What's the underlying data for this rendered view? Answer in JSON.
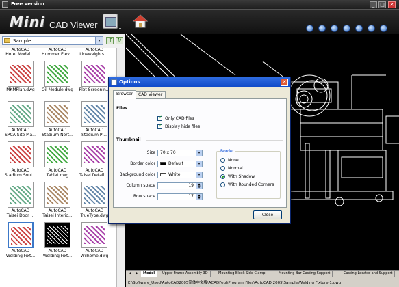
{
  "window": {
    "title": "Free version",
    "min": "_",
    "max": "□",
    "close": "✕"
  },
  "header": {
    "logo_main": "Mini",
    "logo_sub": "CAD Viewer",
    "dropdown_caret": "▾"
  },
  "folder": {
    "name": "Sample",
    "caret": "▾"
  },
  "thumbnails": [
    {
      "top": "AutoCAD",
      "name": "Hotel Model...."
    },
    {
      "top": "AutoCAD",
      "name": "Hummer Elev..."
    },
    {
      "top": "AutoCAD",
      "name": "Lineweights...."
    },
    {
      "top": "",
      "name": "MKMPlan.dwg"
    },
    {
      "top": "",
      "name": "Oil Module.dwg"
    },
    {
      "top": "",
      "name": "Plot Screenin..."
    },
    {
      "top": "AutoCAD",
      "name": "SPCA Site Pla..."
    },
    {
      "top": "AutoCAD",
      "name": "Stadium Nort..."
    },
    {
      "top": "AutoCAD",
      "name": "Stadium Pl..."
    },
    {
      "top": "AutoCAD",
      "name": "Stadium Sout..."
    },
    {
      "top": "AutoCAD",
      "name": "Tablet.dwg"
    },
    {
      "top": "AutoCAD",
      "name": "Taisei Detail ..."
    },
    {
      "top": "AutoCAD",
      "name": "Taisei Door ..."
    },
    {
      "top": "AutoCAD",
      "name": "Taisei Interio..."
    },
    {
      "top": "AutoCAD",
      "name": "TrueType.dwg"
    },
    {
      "top": "AutoCAD",
      "name": "Welding Fixt..."
    },
    {
      "top": "AutoCAD",
      "name": "Welding Fixt..."
    },
    {
      "top": "AutoCAD",
      "name": "Wilhome.dwg"
    }
  ],
  "tabs": [
    "Model",
    "Upper Frame Assembly 3D",
    "Mounting Block Side Clamp",
    "Mounting Bar Casting Support",
    "Casting Locator and Support"
  ],
  "tab_nav": {
    "prev": "◀",
    "next": "▶"
  },
  "status": {
    "path": "E:\\Software_Used\\AutoCAD2005简体中文版\\ACADFeul\\Program Files\\AutoCAD 2005\\Sample\\Welding Fixture-1.dwg"
  },
  "dialog": {
    "title": "Options",
    "close": "✕",
    "tabs": {
      "browser": "Browser",
      "cad": "CAD Viewer"
    },
    "files_section": "Files",
    "only_cad": "Only CAD files",
    "display_hide": "Display hide files",
    "thumbnail_section": "Thumbnail",
    "size_label": "Size",
    "size_value": "70 x 70",
    "border_color_label": "Border color",
    "border_color_value": "Default",
    "bg_color_label": "Background color",
    "bg_color_value": "White",
    "column_space_label": "Column space",
    "column_space_value": "19",
    "row_space_label": "Row space",
    "row_space_value": "17",
    "border_group": "Border",
    "radios": [
      "None",
      "Normal",
      "With Shadow",
      "With Rounded Corners"
    ],
    "close_button": "Close",
    "spin_up": "▲",
    "spin_down": "▼",
    "select_arrow": "▾"
  },
  "colors": {
    "accent": "#0f48c8",
    "canvas_bg": "#000000",
    "cad_lines": "#ffffff"
  }
}
